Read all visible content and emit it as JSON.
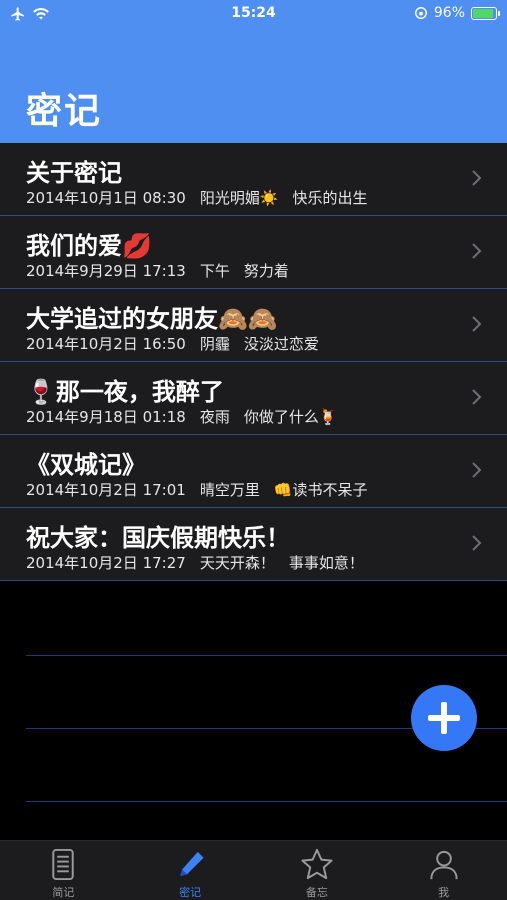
{
  "status_bar": {
    "time": "15:24",
    "battery_percent": "96%",
    "battery_level": 0.96
  },
  "header": {
    "title": "密记",
    "background_color": "#4f8ff1"
  },
  "entries": [
    {
      "title": "关于密记",
      "date": "2014年10月1日 08:30",
      "weather": "阳光明媚☀️",
      "mood": "快乐的出生"
    },
    {
      "title": "我们的爱💋",
      "date": "2014年9月29日 17:13",
      "weather": "下午",
      "mood": "努力着"
    },
    {
      "title": "大学追过的女朋友🙈🙈",
      "date": "2014年10月2日 16:50",
      "weather": "阴霾",
      "mood": "没淡过恋爱"
    },
    {
      "title": "🍷那一夜，我醉了",
      "date": "2014年9月18日 01:18",
      "weather": "夜雨",
      "mood": "你做了什么🍹"
    },
    {
      "title": "《双城记》",
      "date": "2014年10月2日 17:01",
      "weather": "晴空万里",
      "mood": "👊读书不呆子"
    },
    {
      "title": "祝大家：国庆假期快乐！",
      "date": "2014年10月2日 17:27",
      "weather": "天天开森！",
      "mood": "事事如意！"
    }
  ],
  "fab": {
    "icon": "plus-icon",
    "color": "#3478f6"
  },
  "tab_bar": {
    "tabs": [
      {
        "label": "简记",
        "icon": "document-icon",
        "active": false
      },
      {
        "label": "密记",
        "icon": "pen-icon",
        "active": true
      },
      {
        "label": "备忘",
        "icon": "star-icon",
        "active": false
      },
      {
        "label": "我",
        "icon": "person-icon",
        "active": false
      }
    ],
    "active_color": "#3b82f6"
  }
}
